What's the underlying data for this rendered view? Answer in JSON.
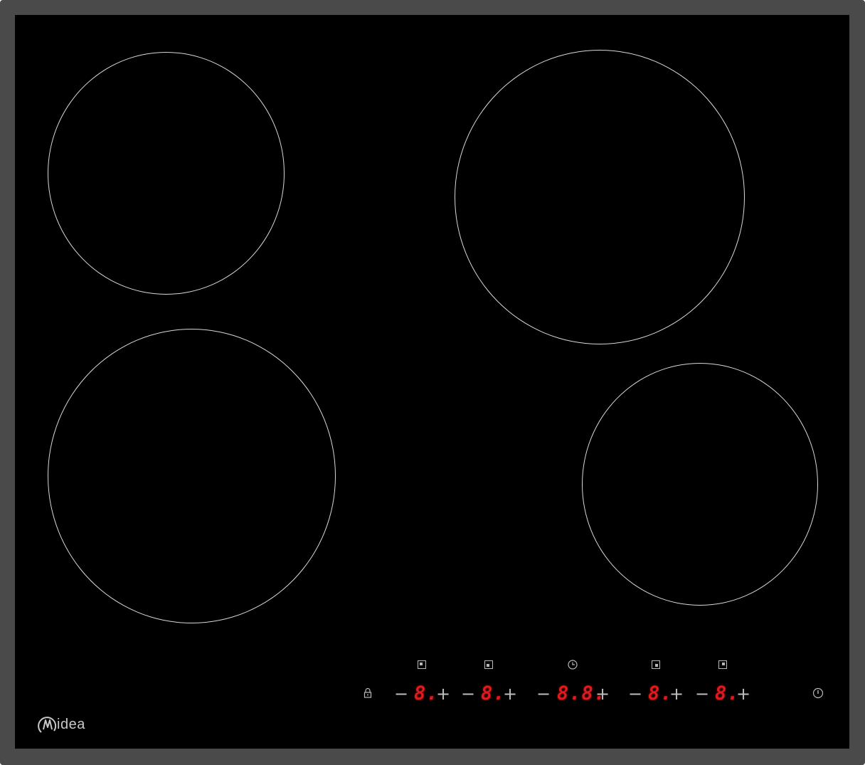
{
  "brand": {
    "name": "idea",
    "logo": "midea-m-logo"
  },
  "colors": {
    "glass": "#000000",
    "frame": "#4a4a4a",
    "zone_outline": "#d8d8d8",
    "display_red": "#e0191d",
    "symbol_grey": "#b9b9b9"
  },
  "controls": {
    "minus_symbol": "−",
    "plus_symbol": "+",
    "zones": {
      "rear_left": {
        "display": "8."
      },
      "front_left": {
        "display": "8."
      },
      "front_right": {
        "display": "8."
      },
      "rear_right": {
        "display": "8."
      }
    },
    "timer": {
      "display": "8.8.",
      "icon": "clock-icon"
    },
    "lock": {
      "icon": "lock-icon"
    },
    "power": {
      "icon": "power-icon"
    }
  }
}
